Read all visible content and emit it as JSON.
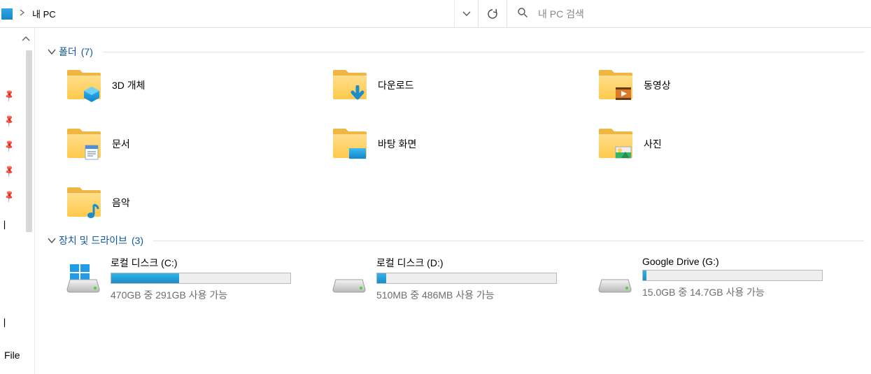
{
  "address": {
    "title": "내 PC",
    "search_placeholder": "내 PC 검색"
  },
  "nav": {
    "cut_label_1": "ㅣ",
    "cut_label_2": "ㅣ",
    "cut_label_3": "File"
  },
  "folders_section": {
    "label": "폴더",
    "count": "(7)"
  },
  "folders": [
    {
      "label": "3D 개체",
      "icon": "3d"
    },
    {
      "label": "다운로드",
      "icon": "downloads"
    },
    {
      "label": "동영상",
      "icon": "videos"
    },
    {
      "label": "문서",
      "icon": "documents"
    },
    {
      "label": "바탕 화면",
      "icon": "desktop"
    },
    {
      "label": "사진",
      "icon": "pictures"
    },
    {
      "label": "음악",
      "icon": "music"
    }
  ],
  "drives_section": {
    "label": "장치 및 드라이브",
    "count": "(3)"
  },
  "drives": [
    {
      "name": "로컬 디스크 (C:)",
      "status": "470GB 중 291GB 사용 가능",
      "used_pct": 38,
      "icon": "windows-drive"
    },
    {
      "name": "로컬 디스크 (D:)",
      "status": "510MB 중 486MB 사용 가능",
      "used_pct": 5,
      "icon": "drive"
    },
    {
      "name": "Google Drive (G:)",
      "status": "15.0GB 중 14.7GB 사용 가능",
      "used_pct": 2,
      "icon": "drive"
    }
  ]
}
